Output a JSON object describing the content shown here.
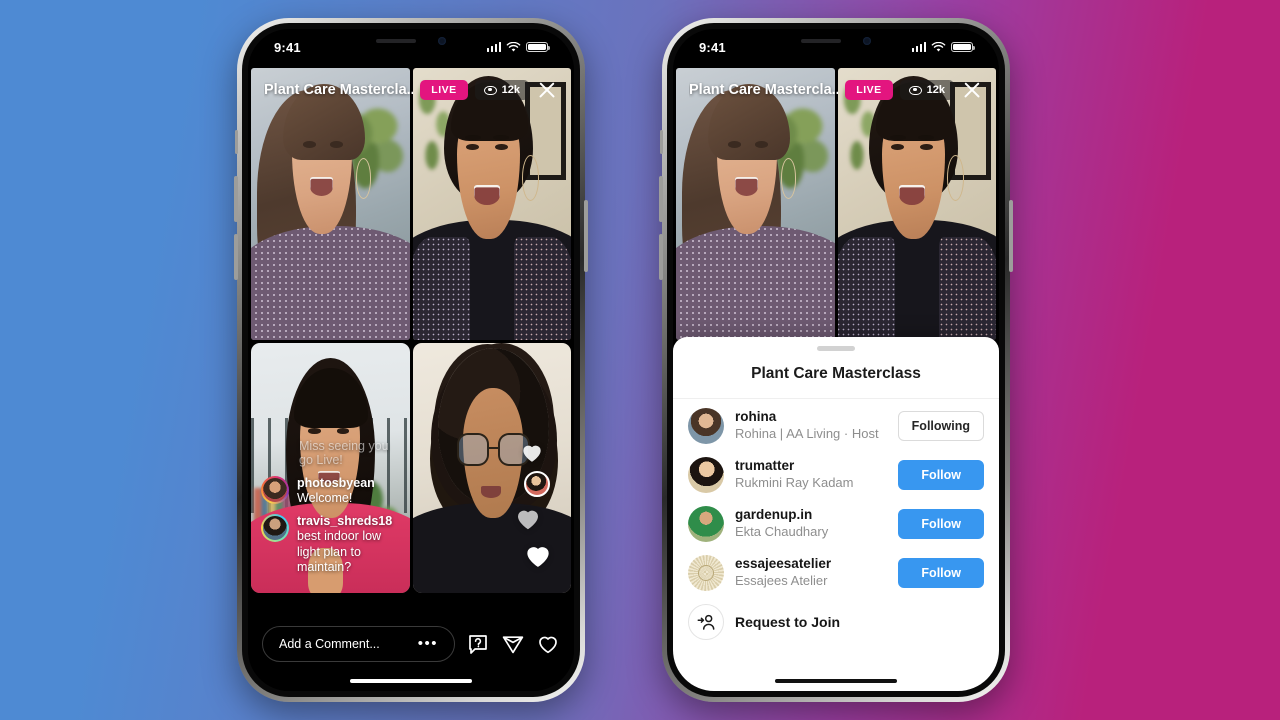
{
  "background": {
    "gradient_from": "#4e8ad3",
    "gradient_mid": "#6b72bd",
    "gradient_to": "#b8217c"
  },
  "status_bar": {
    "time": "9:41",
    "signal_icon": "cellular-signal-icon",
    "wifi_icon": "wifi-icon",
    "battery_icon": "battery-icon"
  },
  "live_header": {
    "title": "Plant Care Mastercla...",
    "live_badge": "LIVE",
    "viewer_count": "12k",
    "viewer_icon": "eye-icon",
    "close_icon": "close-icon"
  },
  "left_phone": {
    "grid": {
      "tiles": [
        {
          "name": "participant-tile-1"
        },
        {
          "name": "participant-tile-2"
        },
        {
          "name": "participant-tile-3"
        },
        {
          "name": "participant-tile-4"
        }
      ]
    },
    "comments": {
      "faded": "Miss seeing you go Live!",
      "items": [
        {
          "user": "photosbyean",
          "text": "Welcome!"
        },
        {
          "user": "travis_shreds18",
          "text": "best indoor low light plan to maintain?"
        }
      ]
    },
    "composer": {
      "placeholder": "Add a Comment...",
      "more_label": "•••",
      "question_icon": "question-chat-icon",
      "send_icon": "paper-plane-icon",
      "like_icon": "heart-icon"
    }
  },
  "right_phone": {
    "sheet": {
      "title": "Plant Care Masterclass",
      "grabber": "sheet-grabber",
      "participants": [
        {
          "username": "rohina",
          "fullname": "Rohina | AA Living · Host",
          "button": "Following",
          "button_state": "following"
        },
        {
          "username": "trumatter",
          "fullname": "Rukmini Ray Kadam",
          "button": "Follow",
          "button_state": "follow"
        },
        {
          "username": "gardenup.in",
          "fullname": "Ekta Chaudhary",
          "button": "Follow",
          "button_state": "follow"
        },
        {
          "username": "essajeesatelier",
          "fullname": "Essajees Atelier",
          "button": "Follow",
          "button_state": "follow"
        }
      ],
      "request_to_join": {
        "label": "Request to Join",
        "icon": "person-add-icon"
      }
    }
  },
  "colors": {
    "live_pink": "#e3157f",
    "follow_blue": "#3897f0",
    "sheet_white": "#ffffff"
  }
}
